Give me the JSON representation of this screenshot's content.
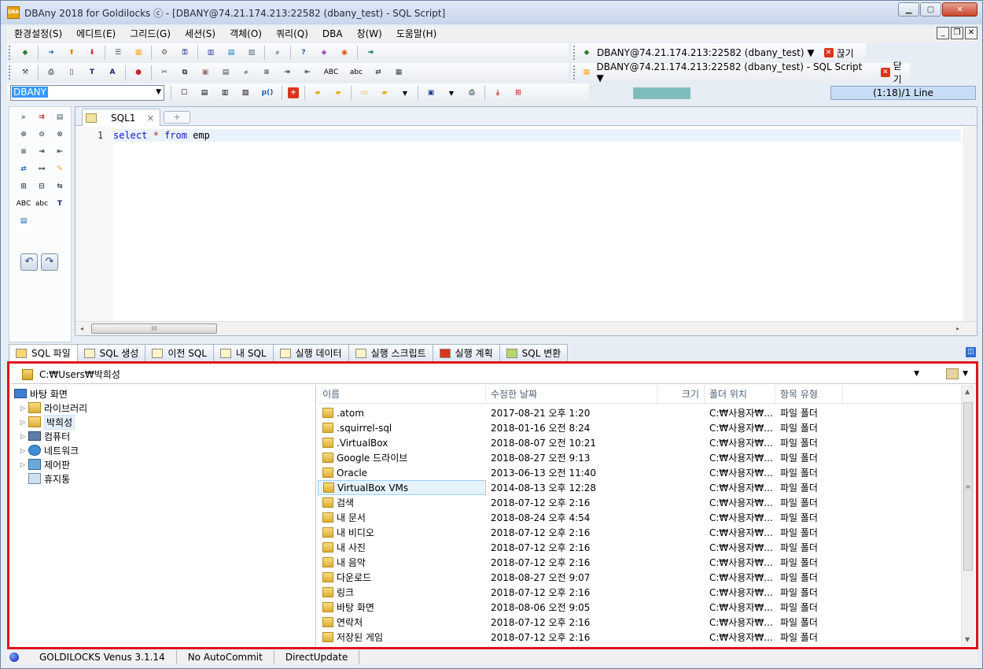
{
  "window": {
    "title": "DBAny 2018 for Goldilocks ⓒ - [DBANY@74.21.174.213:22582 (dbany_test) - SQL Script]",
    "app_icon_label": "DBA"
  },
  "menu": [
    "환경설정(S)",
    "에디트(E)",
    "그리드(G)",
    "세션(S)",
    "객체(O)",
    "쿼리(Q)",
    "DBA",
    "창(W)",
    "도움말(H)"
  ],
  "toolbar": {
    "connection_label": "DBANY@74.21.174.213:22582 (dbany_test) ▼",
    "disconnect_label": "끊기",
    "script_label": "DBANY@74.21.174.213:22582 (dbany_test) - SQL Script ▼",
    "close_label": "닫기",
    "schema_value": "DBANY",
    "cursor_position": "(1:18)/1 Line",
    "text_abc_upper": "ABC",
    "text_abc_lower": "abc",
    "p_label": "p()"
  },
  "palette": {
    "abc_upper": "ABC",
    "abc_lower": "abc"
  },
  "editor": {
    "tab_label": "SQL1",
    "line_number": "1",
    "code": {
      "kw1": "select",
      "star": "*",
      "kw2": "from",
      "table": "emp"
    }
  },
  "bottom_tabs": [
    "SQL 파일",
    "SQL 생성",
    "이전 SQL",
    "내 SQL",
    "실행 데이터",
    "실행 스크립트",
    "실행 계획",
    "SQL 변환"
  ],
  "explorer": {
    "path": "C:₩Users₩박희성",
    "tree": [
      {
        "label": "바탕 화면"
      },
      {
        "label": "라이브러리"
      },
      {
        "label": "박희성"
      },
      {
        "label": "컴퓨터"
      },
      {
        "label": "네트워크"
      },
      {
        "label": "제어판"
      },
      {
        "label": "휴지통"
      }
    ],
    "columns": [
      "이름",
      "수정한 날짜",
      "크기",
      "폴더 위치",
      "항목 유형"
    ],
    "files": [
      {
        "name": ".atom",
        "date": "2017-08-21 오후 1:20",
        "loc": "C:₩사용자₩...",
        "type": "파일 폴더"
      },
      {
        "name": ".squirrel-sql",
        "date": "2018-01-16 오전 8:24",
        "loc": "C:₩사용자₩...",
        "type": "파일 폴더"
      },
      {
        "name": ".VirtualBox",
        "date": "2018-08-07 오전 10:21",
        "loc": "C:₩사용자₩...",
        "type": "파일 폴더"
      },
      {
        "name": "Google 드라이브",
        "date": "2018-08-27 오전 9:13",
        "loc": "C:₩사용자₩...",
        "type": "파일 폴더"
      },
      {
        "name": "Oracle",
        "date": "2013-06-13 오전 11:40",
        "loc": "C:₩사용자₩...",
        "type": "파일 폴더"
      },
      {
        "name": "VirtualBox VMs",
        "date": "2014-08-13 오후 12:28",
        "loc": "C:₩사용자₩...",
        "type": "파일 폴더"
      },
      {
        "name": "검색",
        "date": "2018-07-12 오후 2:16",
        "loc": "C:₩사용자₩...",
        "type": "파일 폴더"
      },
      {
        "name": "내 문서",
        "date": "2018-08-24 오후 4:54",
        "loc": "C:₩사용자₩...",
        "type": "파일 폴더"
      },
      {
        "name": "내 비디오",
        "date": "2018-07-12 오후 2:16",
        "loc": "C:₩사용자₩...",
        "type": "파일 폴더"
      },
      {
        "name": "내 사진",
        "date": "2018-07-12 오후 2:16",
        "loc": "C:₩사용자₩...",
        "type": "파일 폴더"
      },
      {
        "name": "내 음악",
        "date": "2018-07-12 오후 2:16",
        "loc": "C:₩사용자₩...",
        "type": "파일 폴더"
      },
      {
        "name": "다운로드",
        "date": "2018-08-27 오전 9:07",
        "loc": "C:₩사용자₩...",
        "type": "파일 폴더"
      },
      {
        "name": "링크",
        "date": "2018-07-12 오후 2:16",
        "loc": "C:₩사용자₩...",
        "type": "파일 폴더"
      },
      {
        "name": "바탕 화면",
        "date": "2018-08-06 오전 9:05",
        "loc": "C:₩사용자₩...",
        "type": "파일 폴더"
      },
      {
        "name": "연락처",
        "date": "2018-07-12 오후 2:16",
        "loc": "C:₩사용자₩...",
        "type": "파일 폴더"
      },
      {
        "name": "저장된 게임",
        "date": "2018-07-12 오후 2:16",
        "loc": "C:₩사용자₩...",
        "type": "파일 폴더"
      }
    ]
  },
  "status": {
    "driver": "GOLDILOCKS Venus 3.1.14",
    "commit": "No AutoCommit",
    "update": "DirectUpdate"
  },
  "colors": {
    "highlight_border": "#e0141b",
    "accent": "#3399ff"
  }
}
